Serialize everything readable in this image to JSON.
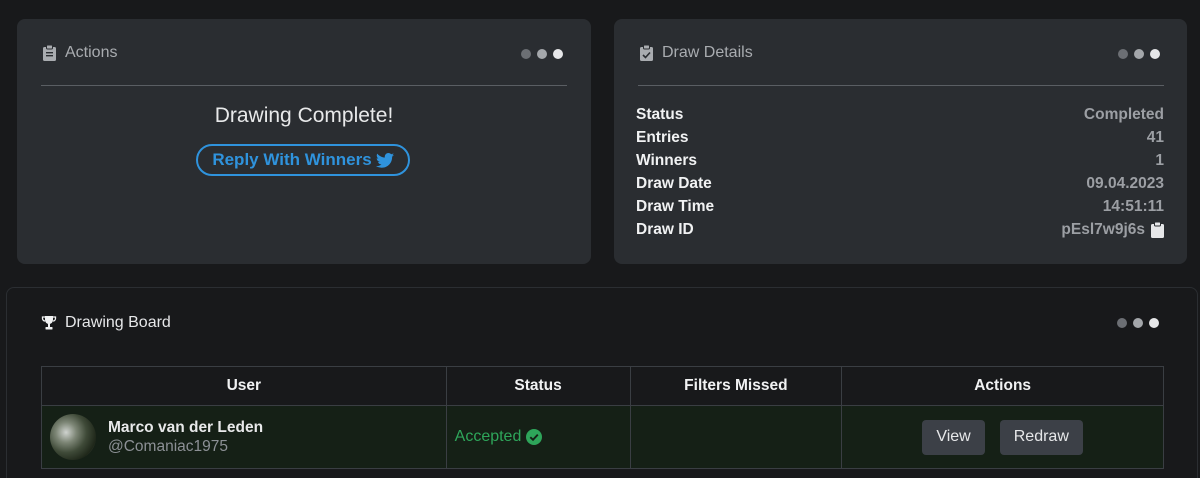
{
  "actions_card": {
    "title": "Actions",
    "icon": "clipboard-icon",
    "heading": "Drawing Complete!",
    "reply_button": "Reply With Winners",
    "reply_icon": "twitter-icon"
  },
  "details_card": {
    "title": "Draw Details",
    "icon": "clipboard-list-icon",
    "rows": [
      {
        "key": "Status",
        "value": "Completed"
      },
      {
        "key": "Entries",
        "value": "41"
      },
      {
        "key": "Winners",
        "value": "1"
      },
      {
        "key": "Draw Date",
        "value": "09.04.2023"
      },
      {
        "key": "Draw Time",
        "value": "14:51:11"
      },
      {
        "key": "Draw ID",
        "value": "pEsl7w9j6s"
      }
    ]
  },
  "board": {
    "title": "Drawing Board",
    "icon": "trophy-icon",
    "columns": [
      "User",
      "Status",
      "Filters Missed",
      "Actions"
    ],
    "rows": [
      {
        "name": "Marco van der Leden",
        "handle": "@Comaniac1975",
        "status": "Accepted",
        "filters_missed": "",
        "view_label": "View",
        "redraw_label": "Redraw"
      }
    ]
  },
  "colors": {
    "accent_blue": "#2f93dd",
    "accepted_green": "#2ea55a",
    "card_bg": "#2a2d31",
    "page_bg": "#18191b"
  }
}
